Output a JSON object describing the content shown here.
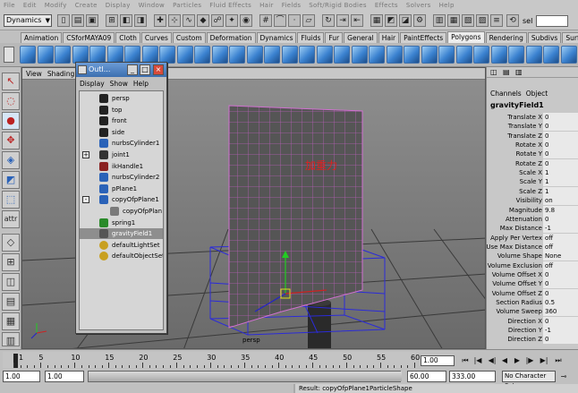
{
  "menubar": [
    "File",
    "Edit",
    "Modify",
    "Create",
    "Display",
    "Window",
    "Particles",
    "Fluid Effects",
    "Hair",
    "Fields",
    "Soft/Rigid Bodies",
    "Effects",
    "Solvers",
    "Help"
  ],
  "status": {
    "module": "Dynamics",
    "sel_label": "sel"
  },
  "tabs": [
    {
      "label": "Animation",
      "active": false
    },
    {
      "label": "CSforMAYA09",
      "active": false
    },
    {
      "label": "Cloth",
      "active": false
    },
    {
      "label": "Curves",
      "active": false
    },
    {
      "label": "Custom",
      "active": false
    },
    {
      "label": "Deformation",
      "active": false
    },
    {
      "label": "Dynamics",
      "active": false
    },
    {
      "label": "Fluids",
      "active": false
    },
    {
      "label": "Fur",
      "active": false
    },
    {
      "label": "General",
      "active": false
    },
    {
      "label": "Hair",
      "active": false
    },
    {
      "label": "PaintEffects",
      "active": false
    },
    {
      "label": "Polygons",
      "active": true
    },
    {
      "label": "Rendering",
      "active": false
    },
    {
      "label": "Subdivs",
      "active": false
    },
    {
      "label": "Surfaces",
      "active": false
    }
  ],
  "viewport": {
    "menu": [
      "View",
      "Shading"
    ],
    "annotation": "加重力",
    "camera": "persp"
  },
  "outliner": {
    "title": "Outl...",
    "menu": [
      "Display",
      "Show",
      "Help"
    ],
    "items": [
      {
        "label": "persp",
        "kind": "camera",
        "selected": false,
        "expand": ""
      },
      {
        "label": "top",
        "kind": "camera",
        "selected": false,
        "expand": ""
      },
      {
        "label": "front",
        "kind": "camera",
        "selected": false,
        "expand": ""
      },
      {
        "label": "side",
        "kind": "camera",
        "selected": false,
        "expand": ""
      },
      {
        "label": "nurbsCylinder1",
        "kind": "nurbs",
        "selected": false,
        "expand": ""
      },
      {
        "label": "joint1",
        "kind": "joint",
        "selected": false,
        "expand": "+"
      },
      {
        "label": "ikHandle1",
        "kind": "ik",
        "selected": false,
        "expand": ""
      },
      {
        "label": "nurbsCylinder2",
        "kind": "nurbs",
        "selected": false,
        "expand": ""
      },
      {
        "label": "pPlane1",
        "kind": "poly",
        "selected": false,
        "expand": ""
      },
      {
        "label": "copyOfpPlane1",
        "kind": "poly",
        "selected": false,
        "expand": "-"
      },
      {
        "label": "copyOfpPlan",
        "kind": "particle",
        "selected": false,
        "expand": ""
      },
      {
        "label": "spring1",
        "kind": "spring",
        "selected": false,
        "expand": ""
      },
      {
        "label": "gravityField1",
        "kind": "field",
        "selected": true,
        "expand": ""
      },
      {
        "label": "defaultLightSet",
        "kind": "set",
        "selected": false,
        "expand": ""
      },
      {
        "label": "defaultObjectSet",
        "kind": "set",
        "selected": false,
        "expand": ""
      }
    ]
  },
  "channels": {
    "menu": [
      "Channels",
      "Object"
    ],
    "object": "gravityField1",
    "attrs": [
      {
        "label": "Translate X",
        "value": "0"
      },
      {
        "label": "Translate Y",
        "value": "0"
      },
      {
        "label": "Translate Z",
        "value": "0"
      },
      {
        "label": "Rotate X",
        "value": "0"
      },
      {
        "label": "Rotate Y",
        "value": "0"
      },
      {
        "label": "Rotate Z",
        "value": "0"
      },
      {
        "label": "Scale X",
        "value": "1"
      },
      {
        "label": "Scale Y",
        "value": "1"
      },
      {
        "label": "Scale Z",
        "value": "1"
      },
      {
        "label": "Visibility",
        "value": "on"
      },
      {
        "label": "Magnitude",
        "value": "9.8"
      },
      {
        "label": "Attenuation",
        "value": "0"
      },
      {
        "label": "Max Distance",
        "value": "-1"
      },
      {
        "label": "Apply Per Vertex",
        "value": "off"
      },
      {
        "label": "Use Max Distance",
        "value": "off"
      },
      {
        "label": "Volume Shape",
        "value": "None"
      },
      {
        "label": "Volume Exclusion",
        "value": "off"
      },
      {
        "label": "Volume Offset X",
        "value": "0"
      },
      {
        "label": "Volume Offset Y",
        "value": "0"
      },
      {
        "label": "Volume Offset Z",
        "value": "0"
      },
      {
        "label": "Section Radius",
        "value": "0.5"
      },
      {
        "label": "Volume Sweep",
        "value": "360"
      },
      {
        "label": "Direction X",
        "value": "0"
      },
      {
        "label": "Direction Y",
        "value": "-1"
      },
      {
        "label": "Direction Z",
        "value": "0"
      }
    ]
  },
  "timeline": {
    "ticks": [
      "1",
      "5",
      "10",
      "15",
      "20",
      "25",
      "30",
      "35",
      "40",
      "45",
      "50",
      "55",
      "60"
    ],
    "current_frame": "1.00",
    "range_start": "1.00",
    "range_inner_start": "1.00",
    "range_inner_end": "60.00",
    "range_end": "333.00",
    "character_set": "No Character Set"
  },
  "command": {
    "result": "Result: copyOfpPlane1ParticleShape"
  }
}
